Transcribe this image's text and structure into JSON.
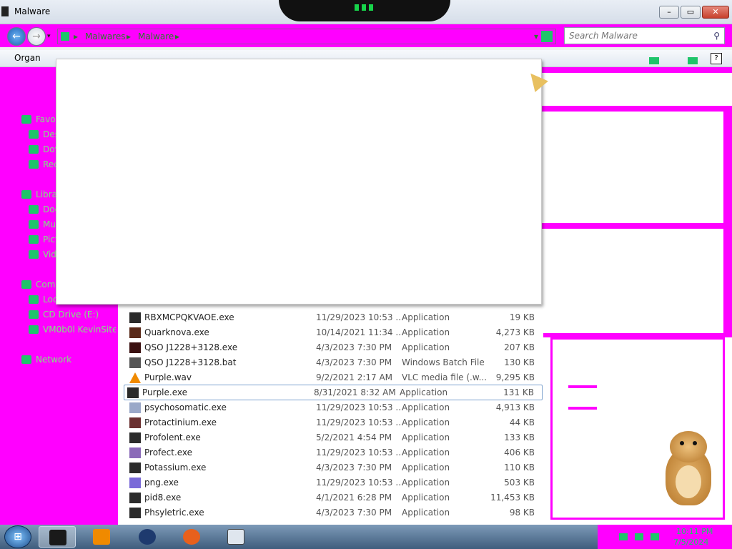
{
  "window": {
    "title": "Malware"
  },
  "title_buttons": {
    "minimize": "–",
    "restore": "▭",
    "close": "✕"
  },
  "nav": {
    "back": "←",
    "forward": "→",
    "recent": "▾",
    "breadcrumb": [
      "▸",
      "Malwares",
      "▸",
      "Malware",
      "▸"
    ],
    "dropdown": "▾"
  },
  "search": {
    "placeholder": "Search Malware",
    "icon": "search-icon"
  },
  "toolbar": {
    "organize": "Organ",
    "help": "?"
  },
  "nav_pane": {
    "items": [
      {
        "label": "Favo",
        "icon": "star-icon"
      },
      {
        "label": "Des",
        "icon": "desktop-icon"
      },
      {
        "label": "Dov",
        "icon": "downloads-icon"
      },
      {
        "label": "Rec",
        "icon": "recent-places-icon"
      },
      {
        "label": "Libra",
        "icon": "libraries-icon"
      },
      {
        "label": "Doc",
        "icon": "documents-icon"
      },
      {
        "label": "Mu",
        "icon": "music-icon"
      },
      {
        "label": "Pict",
        "icon": "pictures-icon"
      },
      {
        "label": "Vide",
        "icon": "videos-icon"
      },
      {
        "label": "Comp",
        "icon": "computer-icon"
      },
      {
        "label": "Loca",
        "icon": "drive-icon"
      },
      {
        "label": "CD Drive (E:)",
        "icon": "cd-drive-icon"
      },
      {
        "label": "VM0b0l KevinSite",
        "icon": "network-drive-icon"
      },
      {
        "label": "Network",
        "icon": "network-icon"
      }
    ]
  },
  "files": [
    {
      "name": "RBXMCPQKVAOE.exe",
      "date": "11/29/2023 10:53 ...",
      "type": "Application",
      "size": "19 KB",
      "icon": "app-icon",
      "color": "#2b2b2b"
    },
    {
      "name": "Quarknova.exe",
      "date": "10/14/2021 11:34 ...",
      "type": "Application",
      "size": "4,273 KB",
      "icon": "cat-icon",
      "color": "#5a2a1a"
    },
    {
      "name": "QSO J1228+3128.exe",
      "date": "4/3/2023 7:30 PM",
      "type": "Application",
      "size": "207 KB",
      "icon": "galaxy-icon",
      "color": "#3a1010"
    },
    {
      "name": "QSO J1228+3128.bat",
      "date": "4/3/2023 7:30 PM",
      "type": "Windows Batch File",
      "size": "130 KB",
      "icon": "batch-icon",
      "color": "#555555"
    },
    {
      "name": "Purple.wav",
      "date": "9/2/2021 2:17 AM",
      "type": "VLC media file (.w...",
      "size": "9,295 KB",
      "icon": "vlc-icon",
      "color": "#f08a00"
    },
    {
      "name": "Purple.exe",
      "date": "8/31/2021 8:32 AM",
      "type": "Application",
      "size": "131 KB",
      "icon": "app-icon",
      "color": "#2b2b2b"
    },
    {
      "name": "psychosomatic.exe",
      "date": "11/29/2023 10:53 ...",
      "type": "Application",
      "size": "4,913 KB",
      "icon": "pattern-icon",
      "color": "#9aa8c8"
    },
    {
      "name": "Protactinium.exe",
      "date": "11/29/2023 10:53 ...",
      "type": "Application",
      "size": "44 KB",
      "icon": "hat-icon",
      "color": "#6a3030"
    },
    {
      "name": "Profolent.exe",
      "date": "5/2/2021 4:54 PM",
      "type": "Application",
      "size": "133 KB",
      "icon": "app-icon",
      "color": "#2b2b2b"
    },
    {
      "name": "Profect.exe",
      "date": "11/29/2023 10:53 ...",
      "type": "Application",
      "size": "406 KB",
      "icon": "glitch-icon",
      "color": "#8a6ab8"
    },
    {
      "name": "Potassium.exe",
      "date": "4/3/2023 7:30 PM",
      "type": "Application",
      "size": "110 KB",
      "icon": "app-icon",
      "color": "#2b2b2b"
    },
    {
      "name": "png.exe",
      "date": "11/29/2023 10:53 ...",
      "type": "Application",
      "size": "503 KB",
      "icon": "puzzle-icon",
      "color": "#7a6ad8"
    },
    {
      "name": "pid8.exe",
      "date": "4/1/2021 6:28 PM",
      "type": "Application",
      "size": "11,453 KB",
      "icon": "app-icon",
      "color": "#2b2b2b"
    },
    {
      "name": "Phsyletric.exe",
      "date": "4/3/2023 7:30 PM",
      "type": "Application",
      "size": "98 KB",
      "icon": "app-icon",
      "color": "#2b2b2b"
    }
  ],
  "selected_file": "Purple.exe",
  "taskbar": {
    "start": "⊞",
    "items": [
      {
        "name": "explorer",
        "color": "#1a1a1a"
      },
      {
        "name": "media-player",
        "color": "#f08a00"
      },
      {
        "name": "globe",
        "color": "#1e3a6e"
      },
      {
        "name": "firefox",
        "color": "#e8601c"
      },
      {
        "name": "notepad",
        "color": "#dfe6ee"
      }
    ],
    "clock_time": "10:11 PM",
    "clock_date": "7/5/2024"
  },
  "colors": {
    "glitch": "#ff00ff",
    "accent_green": "#1fc46a"
  }
}
